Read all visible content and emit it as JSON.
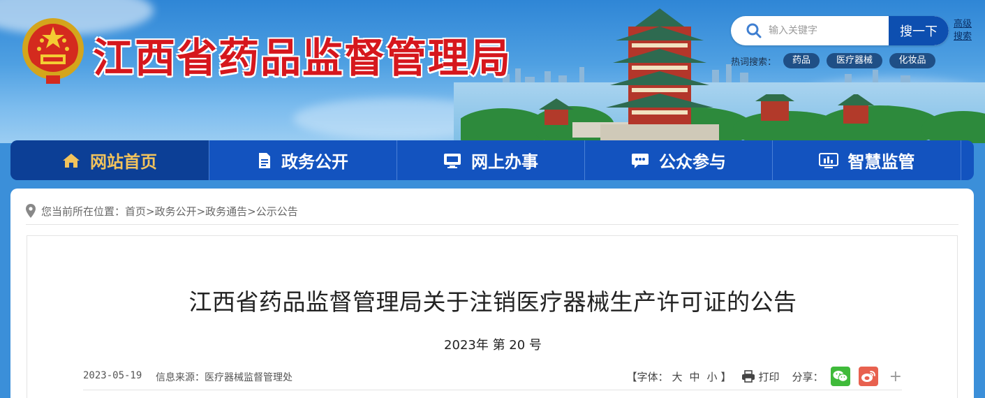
{
  "header": {
    "site_title": "江西省药品监督管理局",
    "search": {
      "placeholder": "输入关键字",
      "button": "搜一下",
      "advanced": "高级搜索"
    },
    "hot": {
      "label": "热词搜索：",
      "tags": [
        "药品",
        "医疗器械",
        "化妆品"
      ]
    }
  },
  "nav": {
    "items": [
      {
        "label": "网站首页",
        "icon": "home-icon",
        "active": true
      },
      {
        "label": "政务公开",
        "icon": "document-icon"
      },
      {
        "label": "网上办事",
        "icon": "monitor-icon"
      },
      {
        "label": "公众参与",
        "icon": "chat-icon"
      },
      {
        "label": "智慧监管",
        "icon": "dashboard-icon"
      }
    ]
  },
  "breadcrumb": {
    "prefix": "您当前所在位置：",
    "path": "您当前所在位置：首页>政务公开>政务通告>公示公告"
  },
  "article": {
    "title": "江西省药品监督管理局关于注销医疗器械生产许可证的公告",
    "number": "2023年 第 20 号",
    "date": "2023-05-19",
    "source": "信息来源：医疗器械监督管理处",
    "font_label_open": "【字体：",
    "font_sizes": [
      "大",
      "中",
      "小"
    ],
    "font_label_close": "】",
    "print_label": "打印",
    "share_label": "分享：",
    "share_more": "+"
  },
  "colors": {
    "nav_bg": "#1353bf",
    "nav_active_bg": "#0c3f96",
    "nav_active_text": "#f2c35c",
    "title_red": "#d6171d",
    "search_button": "#0d4fb0",
    "wechat": "#3fba3a",
    "weibo": "#e8614f"
  }
}
